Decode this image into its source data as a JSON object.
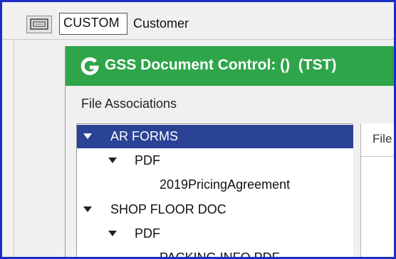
{
  "topbar": {
    "custom_value": "CUSTOM",
    "customer_label": "Customer"
  },
  "dialog": {
    "title": "GSS Document Control: ()  (TST)",
    "header_color": "#2fa54a",
    "section_label": "File Associations",
    "right_panel_label": "File"
  },
  "tree": {
    "selected_color": "#2b4396",
    "items": [
      {
        "label": "AR FORMS",
        "level": 0,
        "expanded": true,
        "selected": true
      },
      {
        "label": "PDF",
        "level": 1,
        "expanded": true,
        "selected": false
      },
      {
        "label": "2019PricingAgreement",
        "level": 2,
        "expanded": false,
        "selected": false
      },
      {
        "label": "SHOP FLOOR DOC",
        "level": 0,
        "expanded": true,
        "selected": false
      },
      {
        "label": "PDF",
        "level": 1,
        "expanded": true,
        "selected": false
      },
      {
        "label": "PACKING INFO.PDF",
        "level": 2,
        "expanded": false,
        "selected": false
      }
    ]
  }
}
